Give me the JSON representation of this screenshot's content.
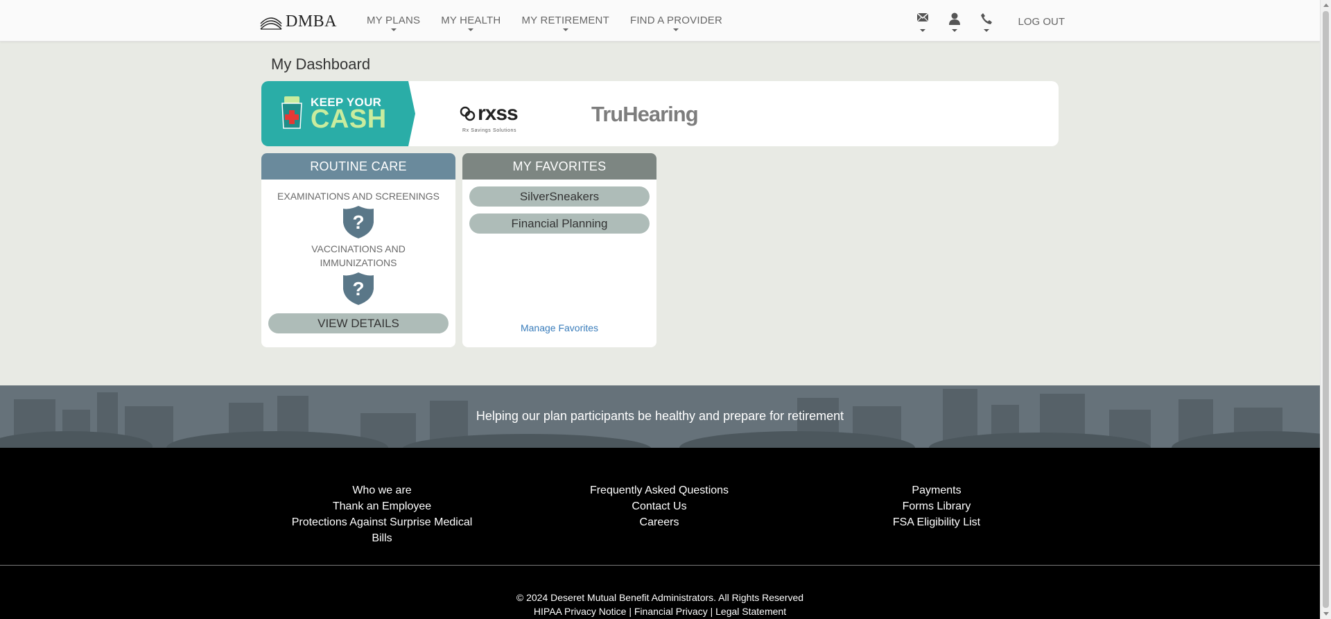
{
  "header": {
    "logo_text": "DMBA",
    "nav": [
      {
        "label": "MY PLANS"
      },
      {
        "label": "MY HEALTH"
      },
      {
        "label": "MY RETIREMENT"
      },
      {
        "label": "FIND A PROVIDER"
      }
    ],
    "icons": [
      "mail-icon",
      "user-icon",
      "phone-icon"
    ],
    "logout_label": "LOG OUT"
  },
  "main": {
    "title": "My Dashboard",
    "partners": {
      "keep_your_cash_line1": "KEEP YOUR",
      "keep_your_cash_line2": "CASH",
      "rxss_name": "rxss",
      "rxss_sub": "Rx Savings Solutions",
      "truhearing": "TruHearing"
    },
    "routine_care": {
      "heading": "ROUTINE CARE",
      "items": [
        {
          "label": "EXAMINATIONS AND SCREENINGS",
          "status_icon": "question-shield-icon"
        },
        {
          "label": "VACCINATIONS AND IMMUNIZATIONS",
          "status_icon": "question-shield-icon"
        }
      ],
      "view_details_label": "VIEW DETAILS"
    },
    "favorites": {
      "heading": "MY FAVORITES",
      "items": [
        {
          "label": "SilverSneakers"
        },
        {
          "label": "Financial Planning"
        }
      ],
      "manage_label": "Manage Favorites"
    }
  },
  "banner": {
    "text": "Helping our plan participants be healthy and prepare for retirement"
  },
  "footer": {
    "col1": [
      "Who we are",
      "Thank an Employee",
      "Protections Against Surprise Medical Bills"
    ],
    "col2": [
      "Frequently Asked Questions",
      "Contact Us",
      "Careers"
    ],
    "col3": [
      "Payments",
      "Forms Library",
      "FSA Eligibility List"
    ],
    "copyright": "© 2024 Deseret Mutual Benefit Administrators. All Rights Reserved",
    "legal": {
      "hipaa": "HIPAA Privacy Notice",
      "financial": "Financial Privacy",
      "statement": "Legal Statement",
      "separator": "|"
    }
  },
  "colors": {
    "page_bg": "#e8eae4",
    "routine_header": "#6a8a9c",
    "favorites_header": "#7d8682",
    "pill": "#aebcb8",
    "kyc_teal": "#2aada7",
    "kyc_green": "#c9ec9e",
    "link_blue": "#3a7dbb"
  }
}
